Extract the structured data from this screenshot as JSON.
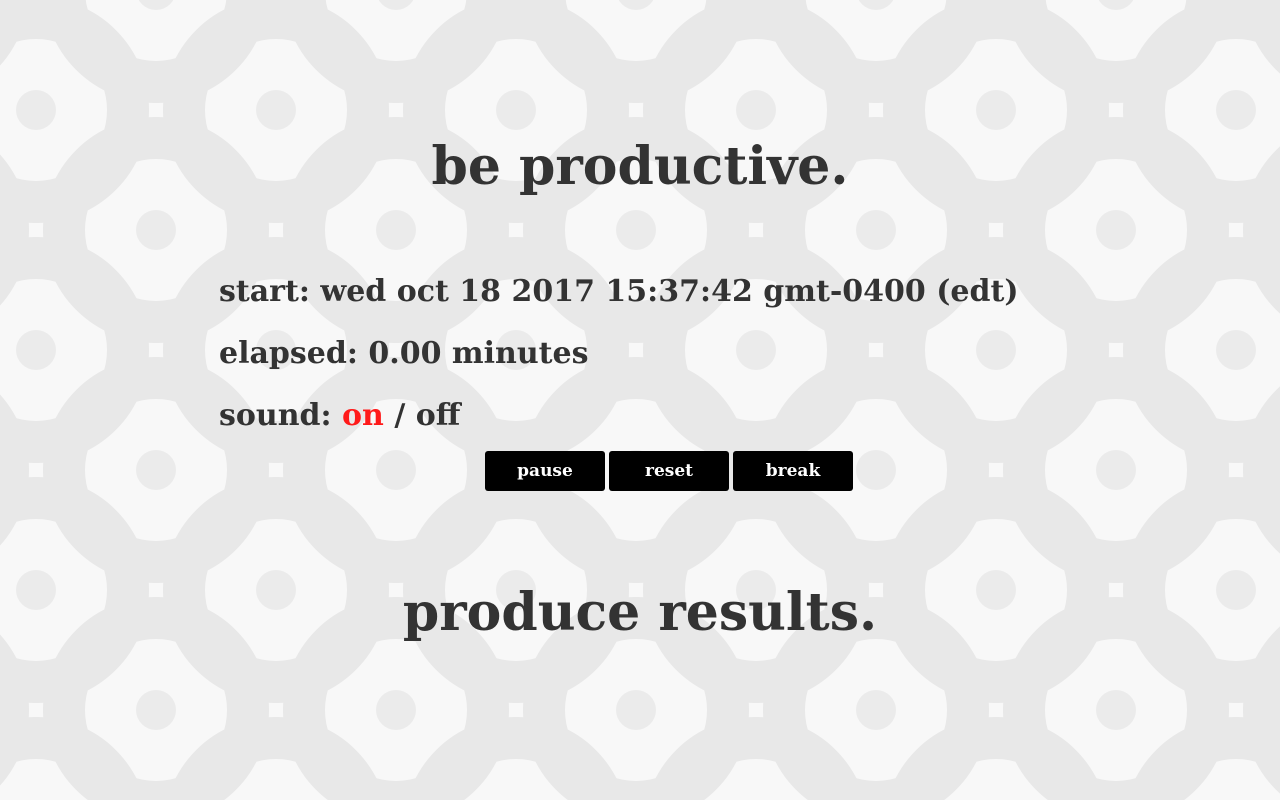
{
  "headline_top": "be productive.",
  "headline_bottom": "produce results.",
  "start": {
    "label": "start:",
    "value": "wed oct 18 2017 15:37:42 gmt-0400 (edt)"
  },
  "elapsed": {
    "label": "elapsed:",
    "value": "0.00",
    "unit": "minutes"
  },
  "sound": {
    "label": "sound:",
    "on_label": "on",
    "separator": "/",
    "off_label": "off",
    "active": "on",
    "active_color": "#ff1a1a"
  },
  "buttons": {
    "pause": "pause",
    "reset": "reset",
    "break": "break"
  },
  "colors": {
    "text": "#333333",
    "button_bg": "#000000",
    "button_text": "#ffffff",
    "background": "#f7f7f7",
    "pattern": "#e6e6e6"
  }
}
